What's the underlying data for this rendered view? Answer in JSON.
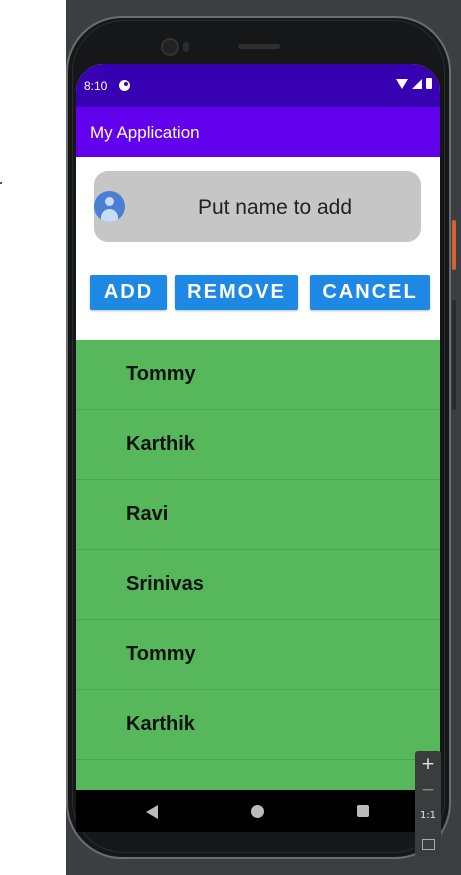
{
  "status_bar": {
    "time": "8:10",
    "icons": [
      "app-notification-icon",
      "wifi-icon",
      "signal-icon",
      "battery-icon"
    ]
  },
  "app_bar": {
    "title": "My Application",
    "color": "#6200ee"
  },
  "name_input": {
    "value": "",
    "placeholder": "Put name to add",
    "icon": "person-icon"
  },
  "buttons": {
    "add_label": "ADD",
    "remove_label": "REMOVE",
    "cancel_label": "CANCEL",
    "color": "#1e88e5"
  },
  "list": {
    "background": "#56b85b",
    "items": [
      {
        "label": "Tommy"
      },
      {
        "label": "Karthik"
      },
      {
        "label": "Ravi"
      },
      {
        "label": "Srinivas"
      },
      {
        "label": "Tommy"
      },
      {
        "label": "Karthik"
      },
      {
        "label": ""
      }
    ]
  },
  "nav_bar": {
    "icons": [
      "back-icon",
      "home-icon",
      "recents-icon"
    ]
  },
  "zoom_controls": {
    "zoom_in": "+",
    "zoom_out": "−",
    "reset": "1:1",
    "icons": [
      "zoom-in-icon",
      "zoom-out-icon",
      "actual-size-icon",
      "fit-screen-icon"
    ]
  }
}
